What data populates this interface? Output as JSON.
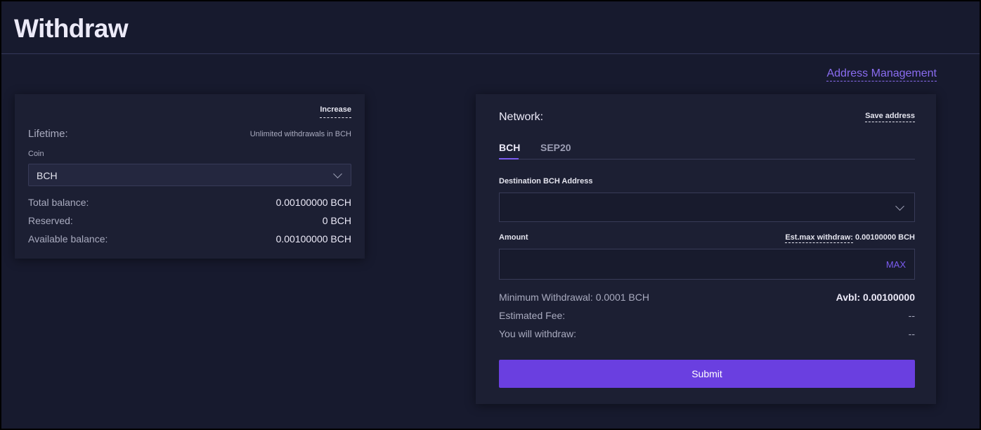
{
  "page": {
    "title": "Withdraw"
  },
  "header_links": {
    "address_management": "Address Management"
  },
  "left_card": {
    "increase_label": "Increase",
    "lifetime_label": "Lifetime:",
    "lifetime_value": "Unlimited withdrawals in BCH",
    "coin_label": "Coin",
    "coin_selected": "BCH",
    "balances": [
      {
        "label": "Total balance:",
        "value": "0.00100000 BCH"
      },
      {
        "label": "Reserved:",
        "value": "0 BCH"
      },
      {
        "label": "Available balance:",
        "value": "0.00100000 BCH"
      }
    ]
  },
  "right_card": {
    "network_label": "Network:",
    "save_address_label": "Save address",
    "tabs": [
      {
        "label": "BCH",
        "active": true
      },
      {
        "label": "SEP20",
        "active": false
      }
    ],
    "destination_label": "Destination BCH Address",
    "destination_value": "",
    "amount_label": "Amount",
    "amount_value": "",
    "est_max_label": "Est.max withdraw:",
    "est_max_value": "0.00100000 BCH",
    "max_label": "MAX",
    "info": [
      {
        "label": "Minimum Withdrawal: 0.0001 BCH",
        "value": "Avbl: 0.00100000"
      },
      {
        "label": "Estimated Fee:",
        "value": "--"
      },
      {
        "label": "You will withdraw:",
        "value": "--"
      }
    ],
    "submit_label": "Submit"
  },
  "colors": {
    "background": "#171a2e",
    "card": "#1c1f33",
    "accent": "#6a3fe0",
    "link": "#8a6cf0"
  }
}
